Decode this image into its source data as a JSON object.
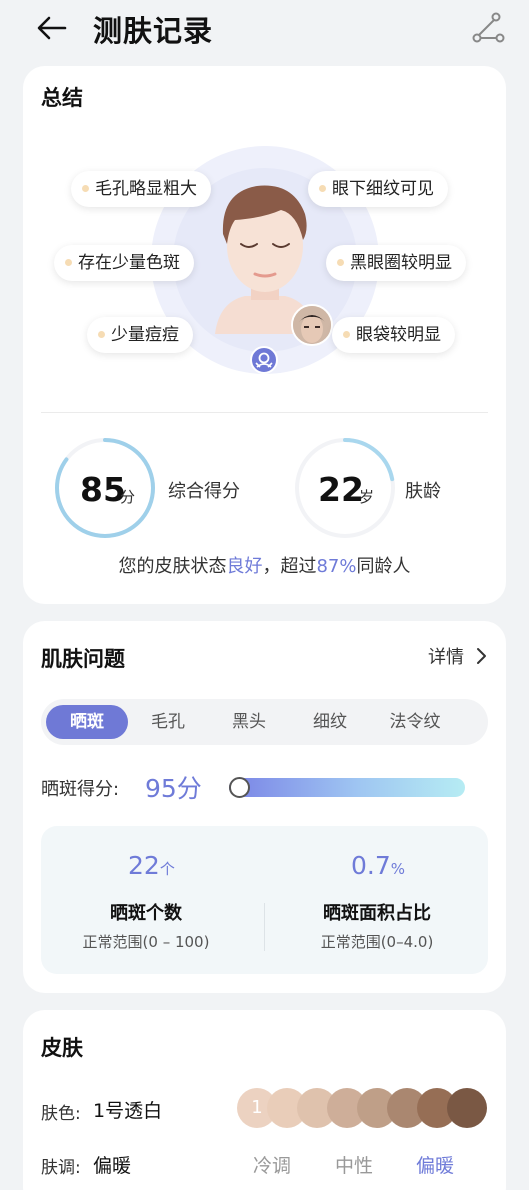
{
  "header": {
    "title": "测肤记录",
    "back_icon": "arrow-left-icon",
    "share_icon": "share-icon"
  },
  "summary": {
    "title": "总结",
    "tags": [
      "毛孔略显粗大",
      "眼下细纹可见",
      "存在少量色斑",
      "黑眼圈较明显",
      "少量痘痘",
      "眼袋较明显"
    ],
    "overall_score": {
      "value": "85",
      "unit": "分",
      "label": "综合得分",
      "progress": 0.85
    },
    "skin_age": {
      "value": "22",
      "unit": "岁",
      "label": "肤龄",
      "progress": 0.22
    },
    "status_line": {
      "prefix": "您的皮肤状态",
      "status": "良好",
      "mid": "，超过",
      "percent": "87%",
      "suffix": "同龄人"
    }
  },
  "issues": {
    "title": "肌肤问题",
    "details_label": "详情",
    "tabs": [
      "晒斑",
      "毛孔",
      "黑头",
      "细纹",
      "法令纹"
    ],
    "active_tab": 0,
    "score_label": "晒斑得分:",
    "score_value": "95分",
    "score_fraction": 0.95,
    "stats": [
      {
        "value": "22",
        "unit": "个",
        "label": "晒斑个数",
        "range": "正常范围(0 – 100)"
      },
      {
        "value": "0.7",
        "unit": "%",
        "label": "晒斑面积占比",
        "range": "正常范围(0–4.0)"
      }
    ]
  },
  "skin": {
    "title": "皮肤",
    "color_label": "肤色:",
    "color_value": "1号透白",
    "selected_swatch": "1",
    "swatch_colors": [
      "#ecd2c1",
      "#e9cdb9",
      "#dfc2ad",
      "#ceae99",
      "#bf9f88",
      "#aa8770",
      "#966e55",
      "#7a5844"
    ],
    "tone_label": "肤调:",
    "tone_value": "偏暖",
    "tone_options": [
      "冷调",
      "中性",
      "偏暖"
    ],
    "active_tone": 2
  },
  "colors": {
    "accent": "#6f79d6",
    "accent_text": "#6f7bd8",
    "tag_dot": "#f6dcb4"
  }
}
